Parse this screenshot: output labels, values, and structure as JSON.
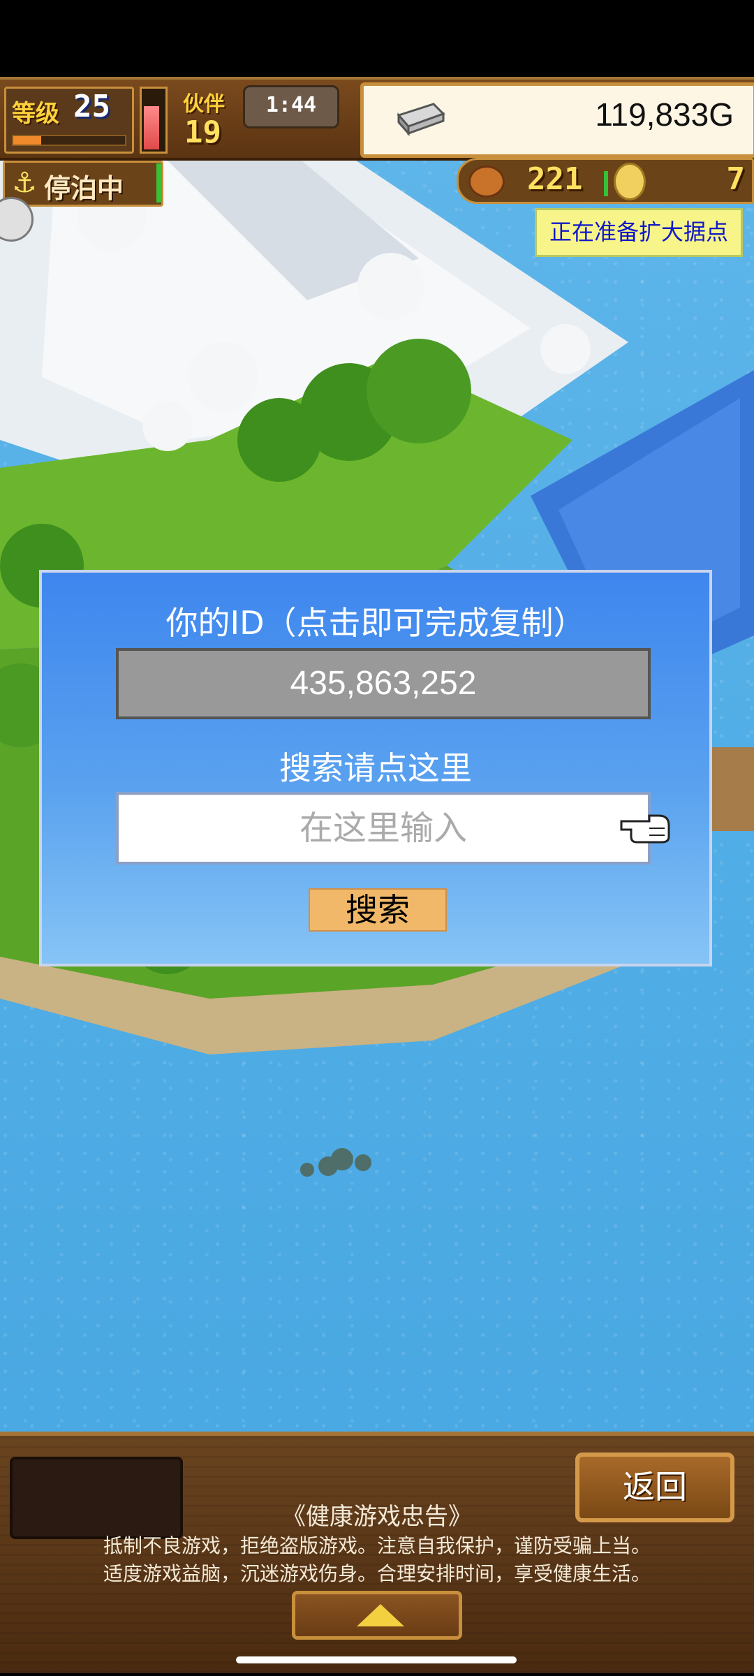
{
  "hud": {
    "level_label": "等级",
    "level_value": "25",
    "level_progress": 0.25,
    "stamina_level": 0.8,
    "crew_label": "伙伴",
    "crew_value": "19",
    "clock": "1:44",
    "gold": "119,833G",
    "status_label": "停泊中",
    "food_value": "221",
    "coin_value": "7",
    "notice": "正在准备扩大据点"
  },
  "dialog": {
    "title": "你的ID（点击即可完成复制）",
    "id_value": "435,863,252",
    "search_label": "搜索请点这里",
    "search_placeholder": "在这里输入",
    "search_button": "搜索"
  },
  "footer": {
    "back_button": "返回",
    "health_title": "《健康游戏忠告》",
    "health_line1": "抵制不良游戏，拒绝盗版游戏。注意自我保护，谨防受骗上当。",
    "health_line2": "适度游戏益脑，沉迷游戏伤身。合理安排时间，享受健康生活。"
  },
  "colors": {
    "dialog_blue": "#3e86ee",
    "search_button": "#f0b868",
    "notice_bg": "#f7f48a",
    "water": "#5fb6ea"
  }
}
